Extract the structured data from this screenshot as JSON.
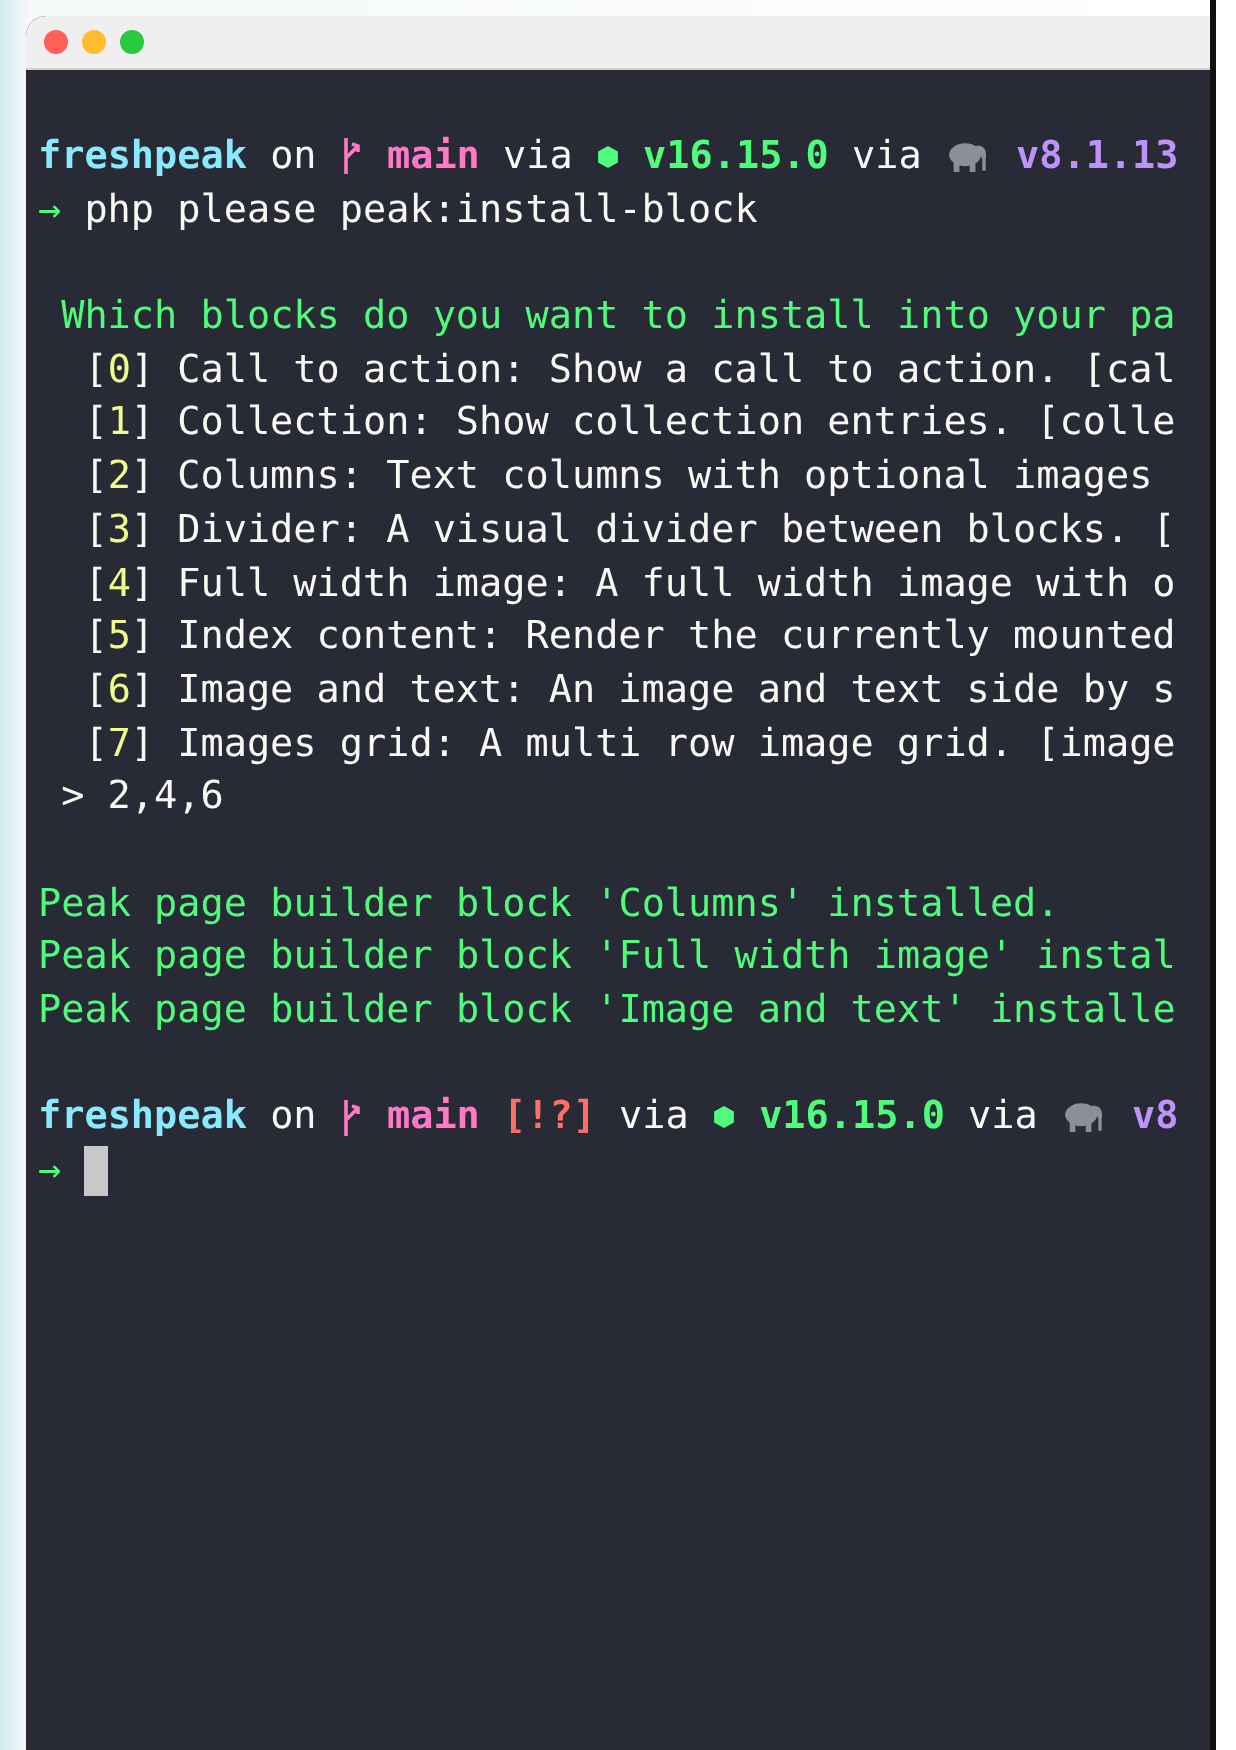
{
  "prompts": [
    {
      "dir": "freshpeak",
      "on": "on",
      "branch": "main",
      "via": "via",
      "node": "v16.15.0",
      "via2": "via",
      "php": "v8.1.13"
    },
    {
      "dir": "freshpeak",
      "on": "on",
      "branch": "main",
      "status": "[!?]",
      "via": "via",
      "node": "v16.15.0",
      "via2": "via",
      "php": "v8"
    }
  ],
  "command": {
    "arrow": "→",
    "text": "php please peak:install-block"
  },
  "question": "Which blocks do you want to install into your pa",
  "options": [
    {
      "open": "[",
      "index": "0",
      "close": "]",
      "text": "Call to action: Show a call to action. [cal"
    },
    {
      "open": "[",
      "index": "1",
      "close": "]",
      "text": "Collection: Show collection entries. [colle"
    },
    {
      "open": "[",
      "index": "2",
      "close": "]",
      "text": "Columns: Text columns with optional images"
    },
    {
      "open": "[",
      "index": "3",
      "close": "]",
      "text": "Divider: A visual divider between blocks. ["
    },
    {
      "open": "[",
      "index": "4",
      "close": "]",
      "text": "Full width image: A full width image with o"
    },
    {
      "open": "[",
      "index": "5",
      "close": "]",
      "text": "Index content: Render the currently mounted"
    },
    {
      "open": "[",
      "index": "6",
      "close": "]",
      "text": "Image and text: An image and text side by s"
    },
    {
      "open": "[",
      "index": "7",
      "close": "]",
      "text": "Images grid: A multi row image grid. [image"
    }
  ],
  "answer": {
    "marker": ">",
    "text": "2,4,6"
  },
  "results": [
    "Peak page builder block 'Columns' installed.",
    "Peak page builder block 'Full width image' instal",
    "Peak page builder block 'Image and text' installe"
  ],
  "cursor_line": {
    "arrow": "→"
  }
}
